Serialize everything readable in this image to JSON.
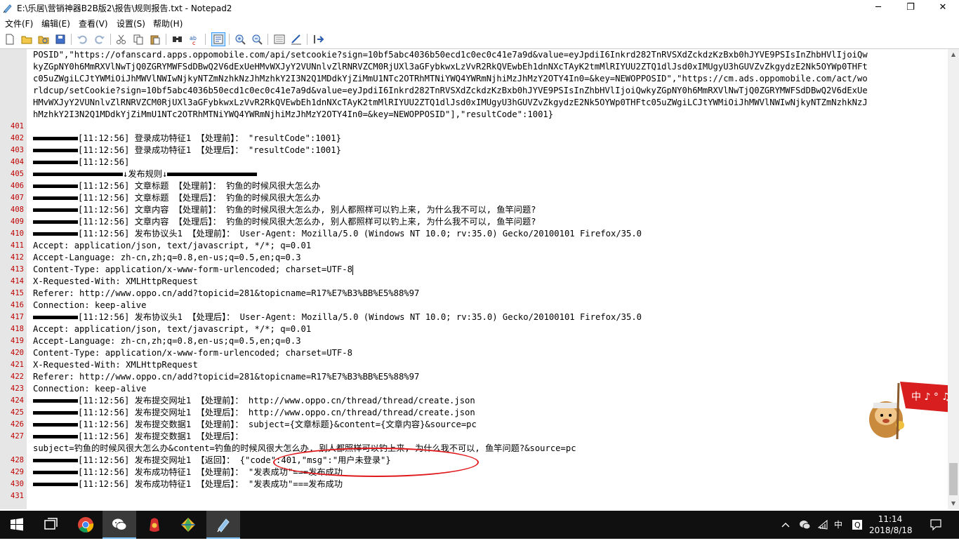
{
  "window": {
    "title": "E:\\乐居\\营销神器B2B版2\\报告\\规则报告.txt - Notepad2",
    "minimize": "─",
    "maximize": "❐",
    "close": "✕"
  },
  "menu": [
    "文件(F)",
    "编辑(E)",
    "查看(V)",
    "设置(S)",
    "帮助(H)"
  ],
  "toolbar_icons": [
    "new-file-icon",
    "open-icon",
    "browse-icon",
    "save-icon",
    "undo-icon",
    "redo-icon",
    "cut-icon",
    "copy-icon",
    "paste-icon",
    "find-icon",
    "replace-icon",
    "word-wrap-icon",
    "zoom-in-icon",
    "zoom-out-icon",
    "scheme-icon",
    "customize-icon",
    "exit-icon"
  ],
  "editor": {
    "lines": [
      {
        "num": "",
        "bars": [],
        "text": "POSID\",\"https://ofanscard.apps.oppomobile.com/api/setcookie?sign=10bf5abc4036b50ecd1c0ec0c41e7a9d&value=eyJpdiI6Inkrd282TnRVSXdZckdzKzBxb0hJYVE9PSIsInZhbHVlIjoiQw"
      },
      {
        "num": "",
        "bars": [],
        "text": "kyZGpNY0h6MmRXVlNwTjQ0ZGRYMWFSdDBwQ2V6dExUeHMvWXJyY2VUNnlvZlRNRVZCM0RjUXl3aGFybkwxLzVvR2RkQVEwbEh1dnNXcTAyK2tmMlRIYUU2ZTQ1dlJsd0xIMUgyU3hGUVZvZkgydzE2Nk5OYWp0THFt"
      },
      {
        "num": "",
        "bars": [],
        "text": "c05uZWgiLCJtYWMiOiJhMWVlNWIwNjkyNTZmNzhkNzJhMzhkY2I3N2Q1MDdkYjZiMmU1NTc2OTRhMTNiYWQ4YWRmNjhiMzJhMzY2OTY4In0=&key=NEWOPPOSID\",\"https://cm.ads.oppomobile.com/act/wo"
      },
      {
        "num": "",
        "bars": [],
        "text": "rldcup/setCookie?sign=10bf5abc4036b50ecd1c0ec0c41e7a9d&value=eyJpdiI6Inkrd282TnRVSXdZckdzKzBxb0hJYVE9PSIsInZhbHVlIjoiQwkyZGpNY0h6MmRXVlNwTjQ0ZGRYMWFSdDBwQ2V6dExUe"
      },
      {
        "num": "",
        "bars": [],
        "text": "HMvWXJyY2VUNnlvZlRNRVZCM0RjUXl3aGFybkwxLzVvR2RkQVEwbEh1dnNXcTAyK2tmMlRIYUU2ZTQ1dlJsd0xIMUgyU3hGUVZvZkgydzE2Nk5OYWp0THFtc05uZWgiLCJtYWMiOiJhMWVlNWIwNjkyNTZmNzhkNzJ"
      },
      {
        "num": "",
        "bars": [],
        "text": "hMzhkY2I3N2Q1MDdkYjZiMmU1NTc2OTRhMTNiYWQ4YWRmNjhiMzJhMzY2OTY4In0=&key=NEWOPPOSID\"],\"resultCode\":1001}"
      },
      {
        "num": "401",
        "bars": [],
        "text": ""
      },
      {
        "num": "402",
        "bars": [
          64
        ],
        "text": "[11:12:56] 登录成功特征1 【处理前】： \"resultCode\":1001}"
      },
      {
        "num": "403",
        "bars": [
          64
        ],
        "text": "[11:12:56] 登录成功特征1 【处理后】： \"resultCode\":1001}"
      },
      {
        "num": "404",
        "bars": [
          64
        ],
        "text": "[11:12:56]"
      },
      {
        "num": "405",
        "bars": [
          128
        ],
        "text": "↓发布规则↓",
        "bar_after": 128
      },
      {
        "num": "406",
        "bars": [
          64
        ],
        "text": "[11:12:56] 文章标题 【处理前】： 钓鱼的时候风很大怎么办"
      },
      {
        "num": "407",
        "bars": [
          64
        ],
        "text": "[11:12:56] 文章标题 【处理后】： 钓鱼的时候风很大怎么办"
      },
      {
        "num": "408",
        "bars": [
          64
        ],
        "text": "[11:12:56] 文章内容 【处理前】： 钓鱼的时候风很大怎么办, 别人都照样可以钓上来, 为什么我不可以, 鱼竿问题?"
      },
      {
        "num": "409",
        "bars": [
          64
        ],
        "text": "[11:12:56] 文章内容 【处理后】： 钓鱼的时候风很大怎么办, 别人都照样可以钓上来, 为什么我不可以, 鱼竿问题?"
      },
      {
        "num": "410",
        "bars": [
          64
        ],
        "text": "[11:12:56] 发布协议头1 【处理前】： User-Agent: Mozilla/5.0 (Windows NT 10.0; rv:35.0) Gecko/20100101 Firefox/35.0"
      },
      {
        "num": "411",
        "bars": [],
        "text": "Accept: application/json, text/javascript, */*; q=0.01"
      },
      {
        "num": "412",
        "bars": [],
        "text": "Accept-Language: zh-cn,zh;q=0.8,en-us;q=0.5,en;q=0.3"
      },
      {
        "num": "413",
        "bars": [],
        "text": "Content-Type: application/x-www-form-urlencoded; charset=UTF-8",
        "caret": true
      },
      {
        "num": "414",
        "bars": [],
        "text": "X-Requested-With: XMLHttpRequest"
      },
      {
        "num": "415",
        "bars": [],
        "text": "Referer: http://www.oppo.cn/add?topicid=281&topicname=R17%E7%B3%BB%E5%88%97"
      },
      {
        "num": "416",
        "bars": [],
        "text": "Connection: keep-alive"
      },
      {
        "num": "417",
        "bars": [
          64
        ],
        "text": "[11:12:56] 发布协议头1 【处理后】： User-Agent: Mozilla/5.0 (Windows NT 10.0; rv:35.0) Gecko/20100101 Firefox/35.0"
      },
      {
        "num": "418",
        "bars": [],
        "text": "Accept: application/json, text/javascript, */*; q=0.01"
      },
      {
        "num": "419",
        "bars": [],
        "text": "Accept-Language: zh-cn,zh;q=0.8,en-us;q=0.5,en;q=0.3"
      },
      {
        "num": "420",
        "bars": [],
        "text": "Content-Type: application/x-www-form-urlencoded; charset=UTF-8"
      },
      {
        "num": "421",
        "bars": [],
        "text": "X-Requested-With: XMLHttpRequest"
      },
      {
        "num": "422",
        "bars": [],
        "text": "Referer: http://www.oppo.cn/add?topicid=281&topicname=R17%E7%B3%BB%E5%88%97"
      },
      {
        "num": "423",
        "bars": [],
        "text": "Connection: keep-alive"
      },
      {
        "num": "424",
        "bars": [
          64
        ],
        "text": "[11:12:56] 发布提交网址1 【处理前】： http://www.oppo.cn/thread/thread/create.json"
      },
      {
        "num": "425",
        "bars": [
          64
        ],
        "text": "[11:12:56] 发布提交网址1 【处理后】： http://www.oppo.cn/thread/thread/create.json"
      },
      {
        "num": "426",
        "bars": [
          64
        ],
        "text": "[11:12:56] 发布提交数据1 【处理前】： subject={文章标题}&content={文章内容}&source=pc"
      },
      {
        "num": "427",
        "bars": [
          64
        ],
        "text": "[11:12:56] 发布提交数据1 【处理后】："
      },
      {
        "num": "",
        "bars": [],
        "text": "subject=钓鱼的时候风很大怎么办&content=钓鱼的时候风很大怎么办, 别人都照样可以钓上来, 为什么我不可以, 鱼竿问题?&source=pc"
      },
      {
        "num": "428",
        "bars": [
          64
        ],
        "text": "[11:12:56] 发布提交网址1 【返回】： {\"code\":401,\"msg\":\"用户未登录\"}"
      },
      {
        "num": "429",
        "bars": [
          64
        ],
        "text": "[11:12:56] 发布成功特征1 【处理前】： \"发表成功\"===发布成功"
      },
      {
        "num": "430",
        "bars": [
          64
        ],
        "text": "[11:12:56] 发布成功特征1 【处理后】： \"发表成功\"===发布成功"
      },
      {
        "num": "431",
        "bars": [],
        "text": ""
      }
    ]
  },
  "taskbar": {
    "apps": [
      "windows-start-icon",
      "task-view-icon",
      "chrome-icon",
      "wechat-icon",
      "red-envelope-app-icon",
      "sketch-app-icon",
      "notepad2-icon"
    ],
    "tray": {
      "ime": "中",
      "time": "11:14",
      "date": "2018/8/18"
    }
  }
}
